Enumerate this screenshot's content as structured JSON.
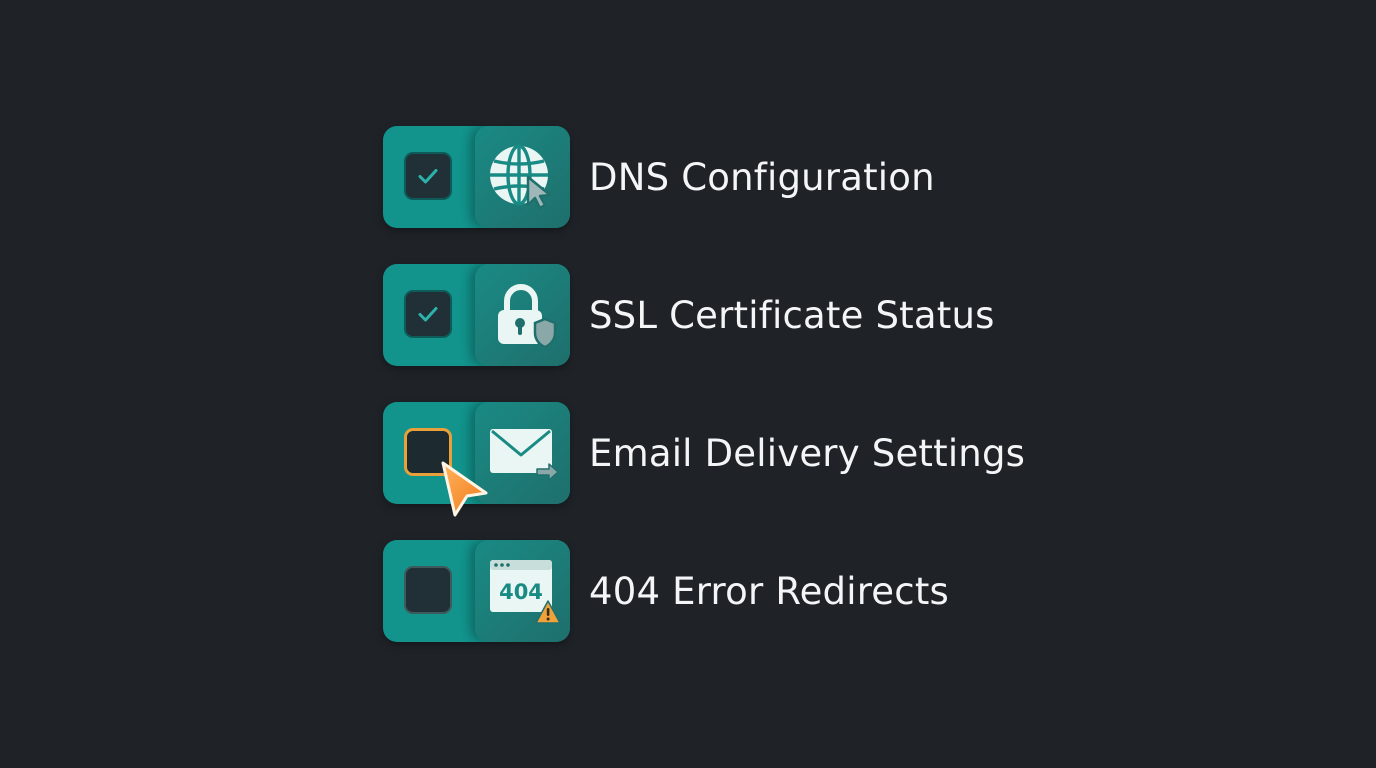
{
  "colors": {
    "background": "#1f2328",
    "tile": "#12938c",
    "checkbox_fill": "#203036",
    "check_mark": "#2bb3ab",
    "focus_ring": "#e8a03a",
    "warning": "#f0a23a",
    "label_text": "#f3f5f6"
  },
  "items": [
    {
      "label": "DNS Configuration",
      "checked": true,
      "icon": "globe-cursor-icon"
    },
    {
      "label": "SSL Certificate Status",
      "checked": true,
      "icon": "padlock-shield-icon"
    },
    {
      "label": "Email Delivery Settings",
      "checked": false,
      "focused": true,
      "icon": "envelope-forward-icon"
    },
    {
      "label": "404 Error Redirects",
      "checked": false,
      "icon": "browser-404-warning-icon"
    }
  ],
  "error_page": {
    "code": "404"
  },
  "cursor": {
    "icon": "orange-pointer-cursor-icon"
  }
}
